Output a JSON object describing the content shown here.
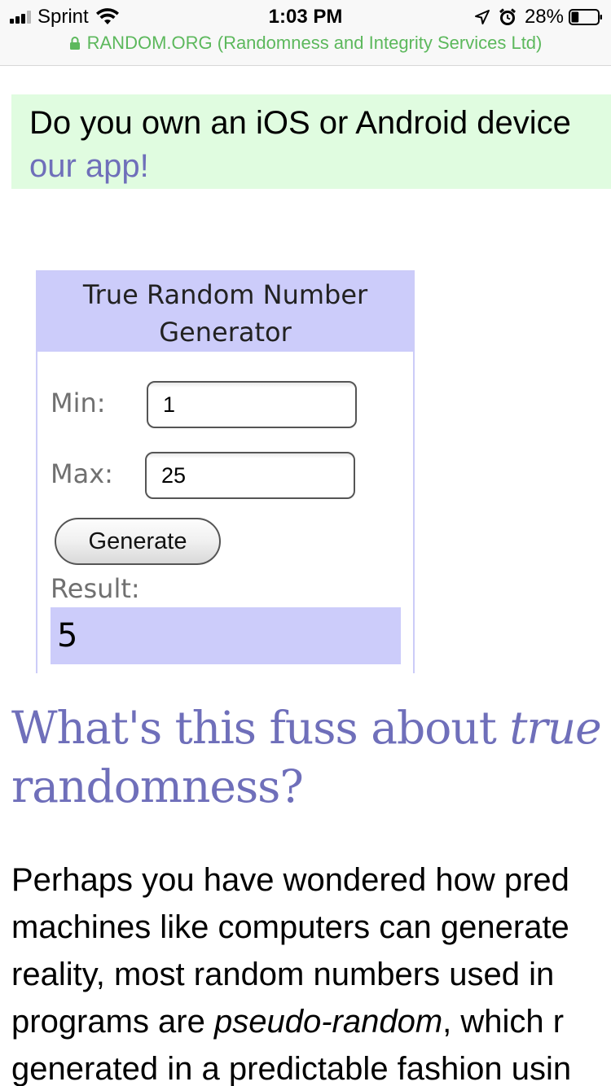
{
  "status_bar": {
    "carrier": "Sprint",
    "time": "1:03 PM",
    "battery_percent": "28%",
    "battery_level": 0.28,
    "icons": [
      "signal-icon",
      "wifi-icon",
      "location-icon",
      "alarm-icon",
      "battery-icon",
      "lock-icon"
    ]
  },
  "browser": {
    "url_text": "RANDOM.ORG (Randomness and Integrity Services Ltd)"
  },
  "banner": {
    "text": "Do you own an iOS or Android device",
    "link_text": "our app!"
  },
  "generator": {
    "title": "True Random Number Generator",
    "min_label": "Min:",
    "min_value": "1",
    "max_label": "Max:",
    "max_value": "25",
    "button_label": "Generate",
    "result_label": "Result:",
    "result_value": "5"
  },
  "article": {
    "heading_part1": "What's this fuss about ",
    "heading_emphasis": "true",
    "heading_part2": "randomness?",
    "paragraph": {
      "line1": "Perhaps you have wondered how pred",
      "line2": "machines like computers can generate",
      "line3": "reality, most random numbers used in",
      "line4_before": "programs are ",
      "line4_emphasis": "pseudo-random",
      "line4_after": ", which r",
      "line5": "generated in a predictable fashion usin"
    }
  },
  "colors": {
    "accent_purple": "#6f6fba",
    "widget_header_bg": "#ccccfa",
    "banner_bg": "#e0fce0",
    "url_green": "#5cb85c"
  }
}
